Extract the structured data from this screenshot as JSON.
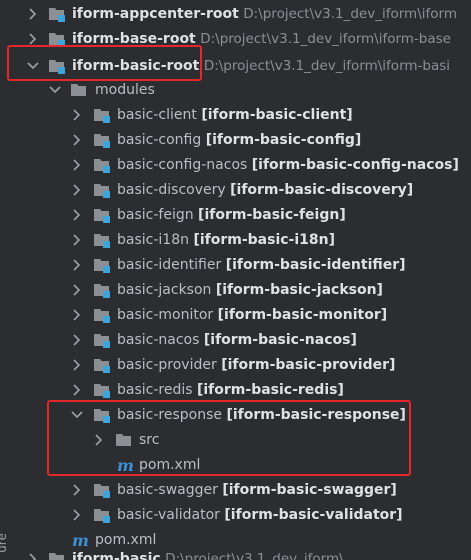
{
  "tree": {
    "roots_above": [
      {
        "name": "iform-appcenter-root",
        "path": "D:\\project\\v3.1_dev_iform\\iform"
      },
      {
        "name": "iform-base-root",
        "path": "D:\\project\\v3.1_dev_iform\\iform-base"
      }
    ],
    "selected_root": {
      "name": "iform-basic-root",
      "path": "D:\\project\\v3.1_dev_iform\\iform-basi"
    },
    "modules_folder": "modules",
    "modules": [
      {
        "name": "basic-client",
        "artifact": "[iform-basic-client]"
      },
      {
        "name": "basic-config",
        "artifact": "[iform-basic-config]"
      },
      {
        "name": "basic-config-nacos",
        "artifact": "[iform-basic-config-nacos]"
      },
      {
        "name": "basic-discovery",
        "artifact": "[iform-basic-discovery]"
      },
      {
        "name": "basic-feign",
        "artifact": "[iform-basic-feign]"
      },
      {
        "name": "basic-i18n",
        "artifact": "[iform-basic-i18n]"
      },
      {
        "name": "basic-identifier",
        "artifact": "[iform-basic-identifier]"
      },
      {
        "name": "basic-jackson",
        "artifact": "[iform-basic-jackson]"
      },
      {
        "name": "basic-monitor",
        "artifact": "[iform-basic-monitor]"
      },
      {
        "name": "basic-nacos",
        "artifact": "[iform-basic-nacos]"
      },
      {
        "name": "basic-provider",
        "artifact": "[iform-basic-provider]"
      },
      {
        "name": "basic-redis",
        "artifact": "[iform-basic-redis]"
      }
    ],
    "expanded_module": {
      "name": "basic-response",
      "artifact": "[iform-basic-response]"
    },
    "expanded_children": {
      "folder": "src",
      "pom": "pom.xml"
    },
    "modules_after": [
      {
        "name": "basic-swagger",
        "artifact": "[iform-basic-swagger]"
      },
      {
        "name": "basic-validator",
        "artifact": "[iform-basic-validator]"
      }
    ],
    "root_pom": "pom.xml",
    "cut_off_row": {
      "name": "iform-basic",
      "path": "D:\\project\\v3.1_dev_iform\\"
    }
  },
  "side_panel_label": "ure",
  "icons": {
    "arrow_right": "chevron-right-icon",
    "arrow_down": "chevron-down-icon",
    "module_folder": "module-folder-icon",
    "folder": "folder-icon",
    "maven": "maven-icon"
  },
  "colors": {
    "background": "#2b2d30",
    "highlight_border": "#e5272b",
    "folder": "#8c8f94",
    "module_badge": "#3fa4d8",
    "maven": "#3d8fd6"
  }
}
